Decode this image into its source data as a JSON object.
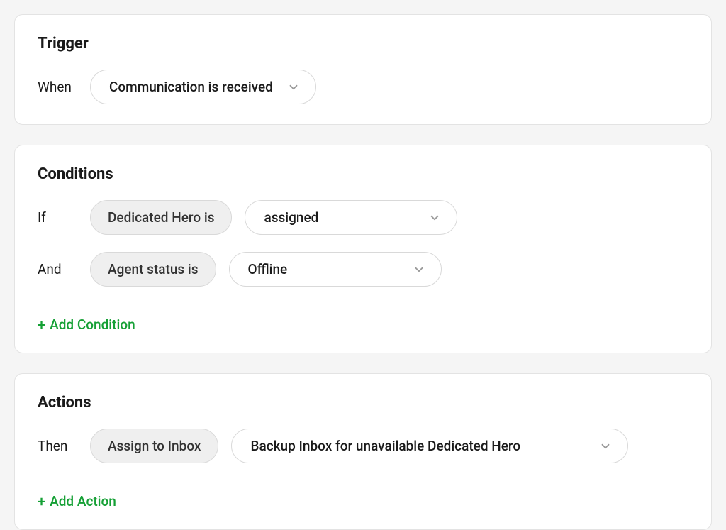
{
  "trigger": {
    "title": "Trigger",
    "when_label": "When",
    "event": "Communication is received"
  },
  "conditions": {
    "title": "Conditions",
    "rows": [
      {
        "joiner": "If",
        "field": "Dedicated Hero is",
        "value": "assigned"
      },
      {
        "joiner": "And",
        "field": "Agent status is",
        "value": "Offline"
      }
    ],
    "add_label": "Add Condition"
  },
  "actions": {
    "title": "Actions",
    "rows": [
      {
        "joiner": "Then",
        "field": "Assign to Inbox",
        "value": "Backup Inbox for unavailable Dedicated Hero"
      }
    ],
    "add_label": "Add Action"
  },
  "icons": {
    "plus": "+"
  }
}
